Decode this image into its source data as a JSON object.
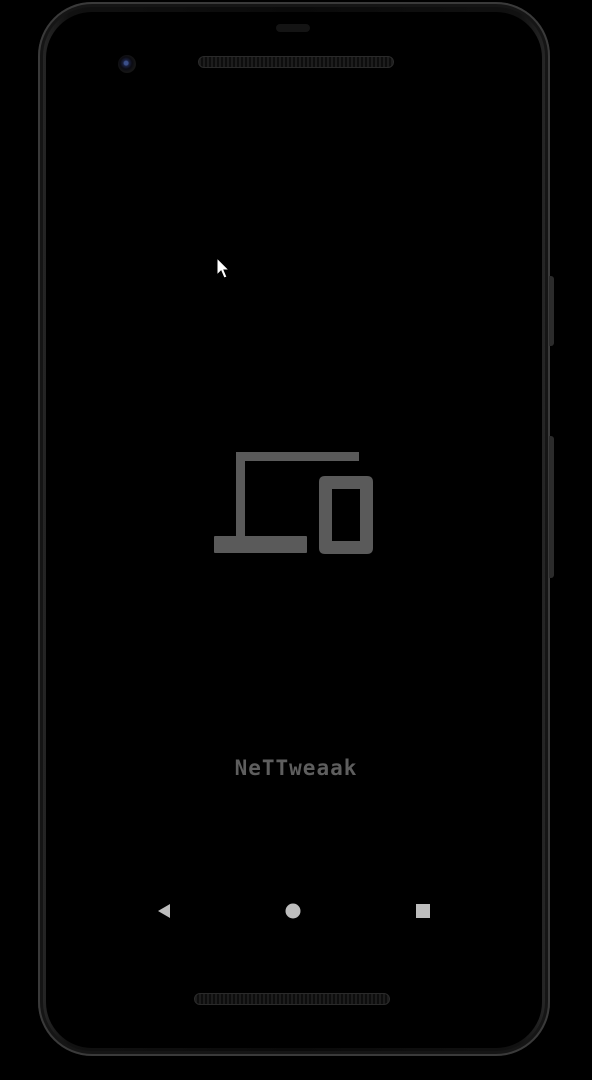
{
  "app": {
    "name": "NeTTweaak"
  },
  "device": {
    "frame_color": "#111111",
    "screen_color": "#000000"
  },
  "splash": {
    "logo_icon": "devices-icon",
    "logo_color": "#5a5a5a",
    "text_color": "#5e5e5e"
  },
  "navigation_bar": {
    "buttons": [
      {
        "icon": "back-triangle-icon"
      },
      {
        "icon": "home-circle-icon"
      },
      {
        "icon": "recents-square-icon"
      }
    ],
    "color": "#bdbdbd"
  }
}
